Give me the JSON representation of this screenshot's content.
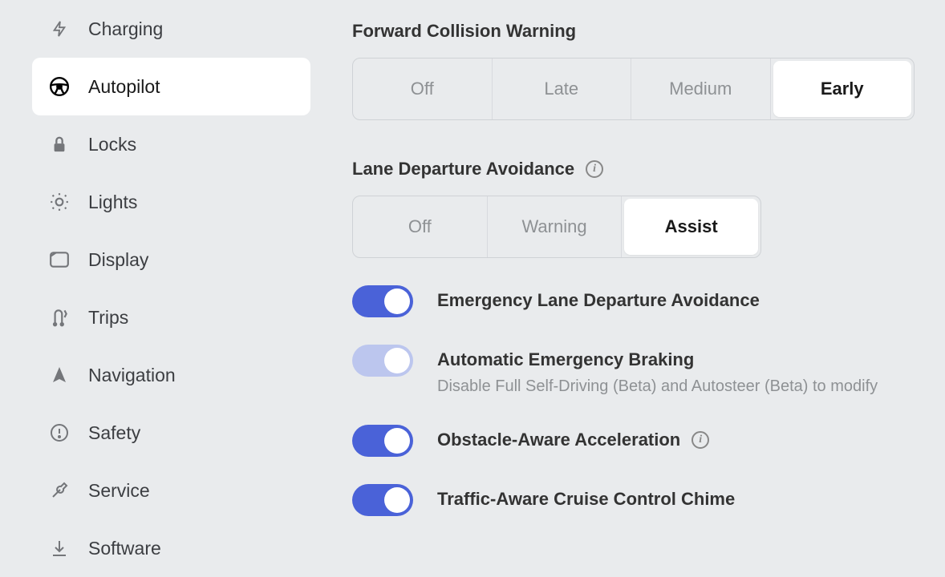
{
  "sidebar": {
    "items": [
      {
        "icon": "bolt",
        "label": "Charging"
      },
      {
        "icon": "wheel",
        "label": "Autopilot",
        "active": true
      },
      {
        "icon": "lock",
        "label": "Locks"
      },
      {
        "icon": "sun",
        "label": "Lights"
      },
      {
        "icon": "display",
        "label": "Display"
      },
      {
        "icon": "trips",
        "label": "Trips"
      },
      {
        "icon": "nav",
        "label": "Navigation"
      },
      {
        "icon": "safety",
        "label": "Safety"
      },
      {
        "icon": "wrench",
        "label": "Service"
      },
      {
        "icon": "download",
        "label": "Software"
      }
    ]
  },
  "main": {
    "fcw": {
      "title": "Forward Collision Warning",
      "options": [
        "Off",
        "Late",
        "Medium",
        "Early"
      ],
      "selected": "Early"
    },
    "lda": {
      "title": "Lane Departure Avoidance",
      "options": [
        "Off",
        "Warning",
        "Assist"
      ],
      "selected": "Assist"
    },
    "toggles": {
      "elda": {
        "label": "Emergency Lane Departure Avoidance",
        "on": true
      },
      "aeb": {
        "label": "Automatic Emergency Braking",
        "sub": "Disable Full Self-Driving (Beta) and Autosteer (Beta) to modify",
        "on": true,
        "disabled": true
      },
      "oaa": {
        "label": "Obstacle-Aware Acceleration",
        "on": true
      },
      "tacc": {
        "label": "Traffic-Aware Cruise Control Chime",
        "on": true
      }
    }
  }
}
